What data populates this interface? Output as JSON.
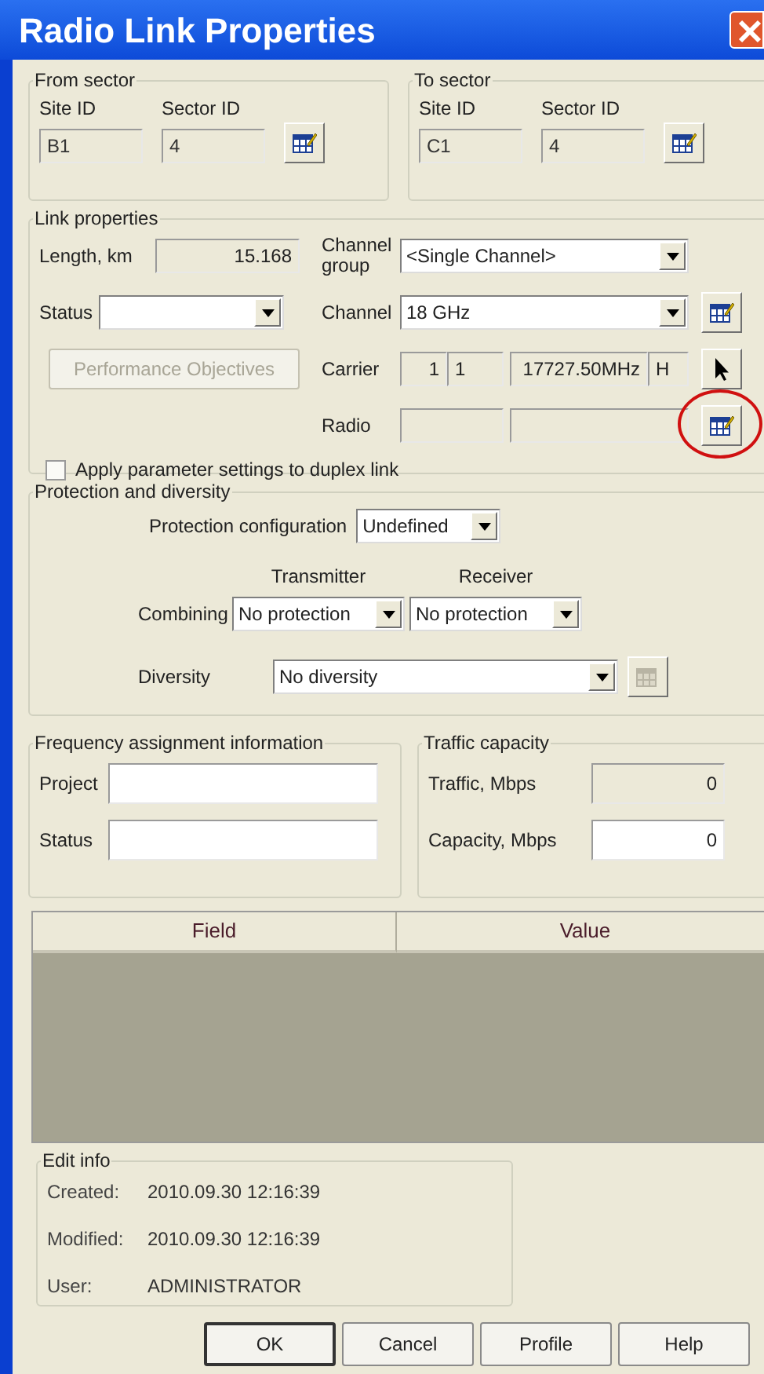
{
  "window": {
    "title": "Radio Link Properties"
  },
  "from_sector": {
    "title": "From sector",
    "site_label": "Site ID",
    "sector_label": "Sector ID",
    "site_id": "B1",
    "sector_id": "4"
  },
  "to_sector": {
    "title": "To sector",
    "site_label": "Site ID",
    "sector_label": "Sector ID",
    "site_id": "C1",
    "sector_id": "4"
  },
  "link_properties": {
    "title": "Link properties",
    "length_label": "Length, km",
    "length": "15.168",
    "status_label": "Status",
    "performance_button": {
      "label": "Performance Objectives",
      "disabled": true
    },
    "channel_group_label": "Channel group",
    "channel_group": "<Single Channel>",
    "channel_label": "Channel",
    "channel": "18 GHz",
    "carrier_label": "Carrier",
    "carrier": [
      "1",
      "1",
      "17727.50MHz",
      "H"
    ],
    "radio_label": "Radio",
    "radio_button": {
      "highlighted": true
    },
    "duplex": {
      "label": "Apply parameter settings to duplex link",
      "checked": false
    }
  },
  "protection": {
    "title": "Protection and diversity",
    "config_label": "Protection configuration",
    "config": "Undefined",
    "transmitter_label": "Transmitter",
    "receiver_label": "Receiver",
    "combining_label": "Combining",
    "transmitter": "No protection",
    "receiver": "No protection",
    "diversity_label": "Diversity",
    "diversity": "No diversity",
    "diversity_button": {
      "disabled": true
    }
  },
  "frequency_assignment": {
    "title": "Frequency assignment information",
    "project_label": "Project",
    "status_label": "Status"
  },
  "traffic_capacity": {
    "title": "Traffic capacity",
    "traffic_label": "Traffic, Mbps",
    "traffic": "0",
    "capacity_label": "Capacity, Mbps",
    "capacity": "0"
  },
  "table": {
    "columns": [
      "Field",
      "Value"
    ]
  },
  "edit_info": {
    "title": "Edit info",
    "rows": [
      {
        "label": "Created:",
        "value": "2010.09.30 12:16:39"
      },
      {
        "label": "Modified:",
        "value": "2010.09.30 12:16:39"
      },
      {
        "label": "User:",
        "value": "ADMINISTRATOR"
      }
    ]
  },
  "buttons": [
    {
      "label": "OK",
      "default": true
    },
    {
      "label": "Cancel",
      "default": false
    },
    {
      "label": "Profile",
      "default": false
    },
    {
      "label": "Help",
      "default": false
    }
  ]
}
